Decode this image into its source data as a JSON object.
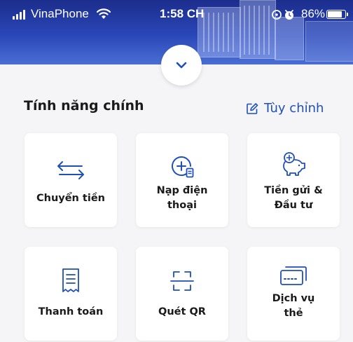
{
  "status_bar": {
    "carrier": "VinaPhone",
    "time": "1:58 CH",
    "battery": "86%"
  },
  "section": {
    "title": "Tính năng chính",
    "customize_label": "Tùy chỉnh"
  },
  "features": [
    {
      "label": "Chuyển tiền",
      "icon": "transfer-arrows-icon"
    },
    {
      "label": "Nạp điện\nthoại",
      "icon": "phone-topup-icon"
    },
    {
      "label": "Tiền gửi &\nĐầu tư",
      "icon": "piggy-bank-icon"
    },
    {
      "label": "Thanh toán",
      "icon": "receipt-icon"
    },
    {
      "label": "Quét QR",
      "icon": "qr-scan-icon"
    },
    {
      "label": "Dịch vụ\nthẻ",
      "icon": "card-service-icon"
    }
  ],
  "colors": {
    "accent": "#1f4fb8",
    "header": "#2a47b8",
    "background": "#f5f5f7"
  }
}
